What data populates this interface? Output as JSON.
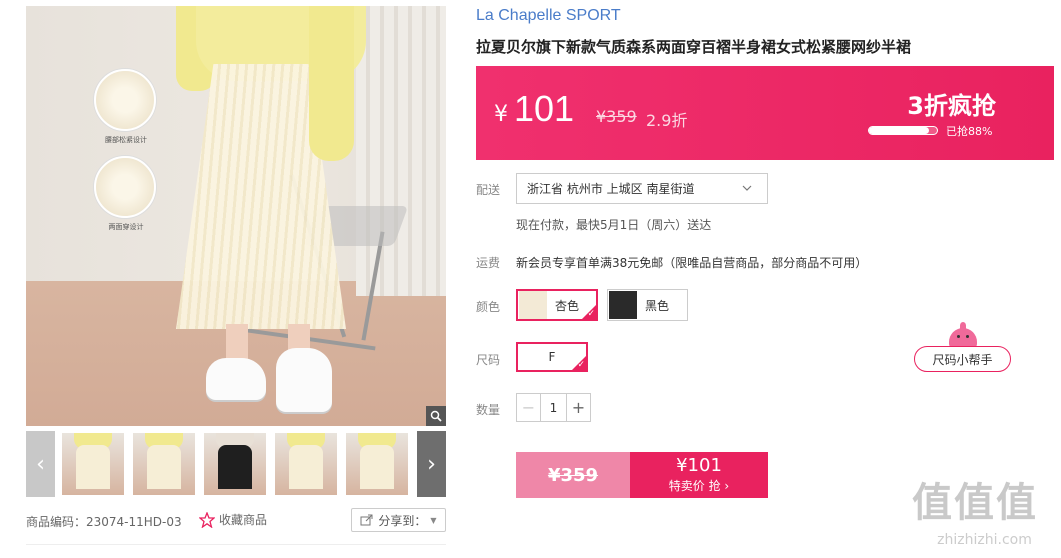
{
  "product": {
    "brand": "La Chapelle SPORT",
    "title": "拉夏贝尔旗下新款气质森系两面穿百褶半身裙女式松紧腰网纱半裙",
    "sku_code": "商品编码：23074-11HD-03"
  },
  "gallery": {
    "detail_caption_1": "腰部松紧设计",
    "detail_caption_2": "两面穿设计",
    "thumbs": [
      {
        "skirt_color": "#f6eed6"
      },
      {
        "skirt_color": "#f6eed6"
      },
      {
        "skirt_color": "#1f1f1f"
      },
      {
        "skirt_color": "#f6eed6"
      },
      {
        "skirt_color": "#f6eed6"
      }
    ],
    "left_arrow": "‹",
    "right_arrow": "›"
  },
  "actions": {
    "favorite": "收藏商品",
    "share": "分享到："
  },
  "price": {
    "currency": "¥",
    "current": "101",
    "original": "¥359",
    "discount": "2.9折",
    "flash_title": "3折疯抢",
    "sold_percent": 88,
    "sold_text": "已抢88%"
  },
  "delivery": {
    "label": "配送",
    "address": "浙江省 杭州市 上城区 南星街道",
    "eta": "现在付款，最快5月1日（周六）送达"
  },
  "shipping": {
    "label": "运费",
    "text": "新会员专享首单满38元免邮（限唯品自营商品，部分商品不可用）"
  },
  "color": {
    "label": "颜色",
    "options": [
      {
        "name": "杏色",
        "swatch": "#f3ead6",
        "selected": true
      },
      {
        "name": "黑色",
        "swatch": "#2a2a2a",
        "selected": false
      }
    ]
  },
  "size": {
    "label": "尺码",
    "option": "F",
    "helper": "尺码小帮手"
  },
  "quantity": {
    "label": "数量",
    "value": "1",
    "minus": "−",
    "plus": "+"
  },
  "buy": {
    "original": "¥359",
    "price": "¥101",
    "label": "特卖价 抢 ›"
  },
  "watermark": {
    "chars": "值值值",
    "url": "zhizhizhi.com"
  },
  "colors": {
    "accent": "#e9225f",
    "brand_link": "#4a7cc9"
  }
}
